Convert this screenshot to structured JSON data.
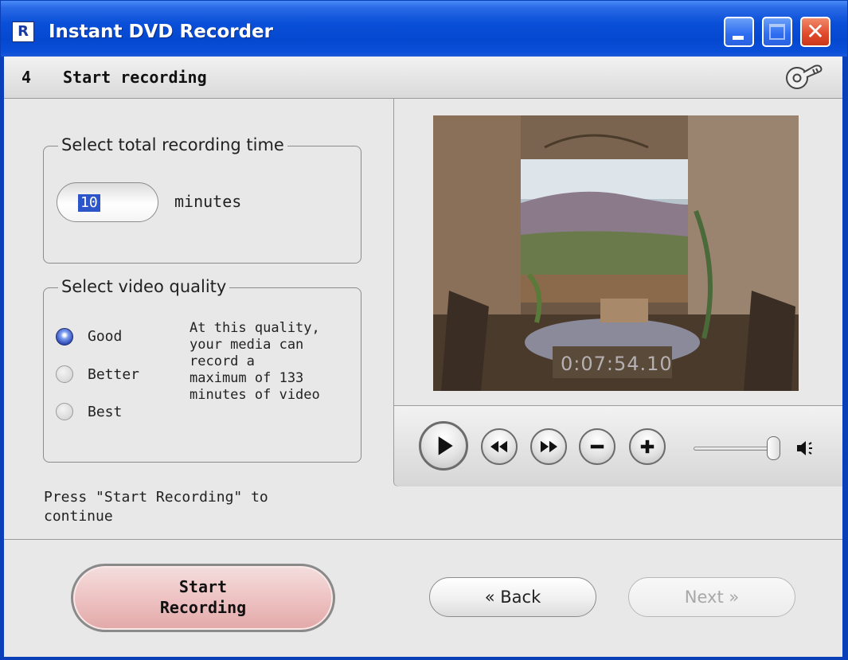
{
  "window": {
    "title": "Instant DVD Recorder",
    "icon_letter": "R",
    "controls": [
      "minimize-icon",
      "maximize-icon",
      "close-icon"
    ]
  },
  "step": {
    "number": "4",
    "title": "Start recording",
    "help_icon": "disc-key-icon"
  },
  "recording_time": {
    "legend": "Select total recording time",
    "value": "10",
    "unit": "minutes"
  },
  "quality": {
    "legend": "Select video quality",
    "options": [
      {
        "label": "Good",
        "checked": true
      },
      {
        "label": "Better",
        "checked": false
      },
      {
        "label": "Best",
        "checked": false
      }
    ],
    "description": "At this quality,\nyour media can\nrecord a\nmaximum of 133\nminutes of video"
  },
  "instruction": "Press \"Start Recording\" to\ncontinue",
  "preview": {
    "timecode": "0:07:54.10",
    "controls": [
      "play-icon",
      "rewind-icon",
      "fast-forward-icon",
      "zoom-out-icon",
      "zoom-in-icon"
    ],
    "volume_level": 0.95,
    "speaker_icon": "speaker-icon"
  },
  "footer": {
    "start_label": "Start\nRecording",
    "back_label": "« Back",
    "next_label": "Next »",
    "next_enabled": false
  },
  "colors": {
    "titlebar": "#0548d0",
    "close_button": "#e0482a",
    "start_button": "#f0c8c8",
    "selection": "#2b55c8",
    "client_bg": "#e8e8e8"
  }
}
